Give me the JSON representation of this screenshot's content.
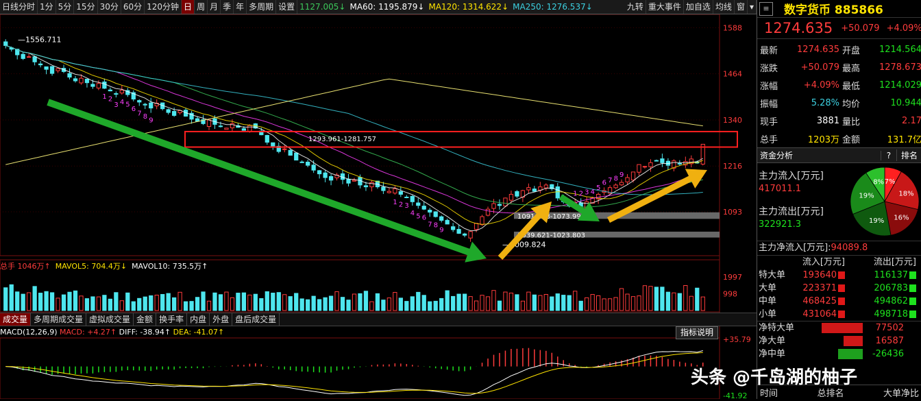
{
  "toolbar": {
    "items": [
      "日线分时",
      "1分",
      "5分",
      "15分",
      "30分",
      "60分",
      "120分钟",
      "日",
      "周",
      "月",
      "季",
      "年",
      "多周期",
      "设置"
    ],
    "active": "日",
    "ma_values": [
      {
        "text": "1127.005↓",
        "color": "#3cc85a"
      },
      {
        "text": "MA60: 1195.879↓",
        "color": "#ffffff"
      },
      {
        "text": "MA120: 1314.622↓",
        "color": "#ffe400"
      },
      {
        "text": "MA250: 1276.537↓",
        "color": "#3cd0e0"
      }
    ],
    "right_items": [
      "九转",
      "重大事件",
      "加自选",
      "均线",
      "窗"
    ]
  },
  "chart_data": {
    "type": "candlestick",
    "price_axis_ticks": [
      1588,
      1464,
      1340,
      1216,
      1093
    ],
    "price_range": [
      975,
      1620
    ],
    "high_label": "1556.711",
    "low_label": "1009.824",
    "zone_labels": [
      {
        "text": "1293.961-1281.757",
        "price": 1290,
        "color": "#ffffff"
      },
      {
        "text": "1091.568-1073.992",
        "price": 1082,
        "color": "#ffffff"
      },
      {
        "text": "1039.621-1023.803",
        "price": 1031,
        "color": "#ffffff"
      }
    ],
    "resistance_box": {
      "low": 1281.757,
      "high": 1293.961
    },
    "support_zones": [
      {
        "low": 1073.992,
        "high": 1091.568
      },
      {
        "low": 1023.803,
        "high": 1039.621
      }
    ],
    "td_counts_down1": [
      "1",
      "2",
      "3",
      "4",
      "5",
      "6",
      "7",
      "8",
      "9"
    ],
    "td_counts_down2": [
      "1",
      "2",
      "3",
      "4",
      "5",
      "6",
      "7",
      "8",
      "9"
    ],
    "td_counts_up": [
      "1",
      "2",
      "3",
      "4",
      "5",
      "6",
      "7",
      "8",
      "9"
    ],
    "close_series": [
      1540,
      1530,
      1515,
      1505,
      1510,
      1496,
      1488,
      1476,
      1465,
      1478,
      1470,
      1455,
      1445,
      1452,
      1440,
      1430,
      1438,
      1425,
      1418,
      1410,
      1420,
      1408,
      1396,
      1388,
      1380,
      1372,
      1385,
      1370,
      1360,
      1352,
      1365,
      1350,
      1342,
      1336,
      1330,
      1340,
      1328,
      1322,
      1318,
      1330,
      1320,
      1312,
      1325,
      1318,
      1300,
      1280,
      1270,
      1255,
      1262,
      1245,
      1232,
      1225,
      1218,
      1205,
      1195,
      1185,
      1178,
      1192,
      1180,
      1170,
      1178,
      1165,
      1160,
      1172,
      1160,
      1150,
      1148,
      1155,
      1140,
      1132,
      1120,
      1110,
      1100,
      1092,
      1080,
      1070,
      1060,
      1045,
      1035,
      1030,
      1040,
      1062,
      1080,
      1100,
      1115,
      1110,
      1130,
      1140,
      1135,
      1150,
      1158,
      1148,
      1160,
      1165,
      1155,
      1130,
      1120,
      1110,
      1118,
      1108,
      1120,
      1130,
      1140,
      1150,
      1158,
      1165,
      1172,
      1185,
      1200,
      1220,
      1215,
      1225,
      1230,
      1225,
      1218,
      1230,
      1222,
      1228,
      1235,
      1224,
      1274.6
    ],
    "volume_axis_ticks": [
      1997,
      998
    ],
    "volume_unit": "万",
    "macd_axis_ticks": [
      35.79,
      -41.92
    ]
  },
  "volume_header": {
    "total": "总手 1046万↑",
    "mavol5": "MAVOL5: 704.4万↓",
    "mavol10": "MAVOL10: 735.5万↑"
  },
  "volume_tabs": [
    "成交量",
    "多周期成交量",
    "虚拟成交量",
    "金额",
    "换手率",
    "内盘",
    "外盘",
    "盘后成交量"
  ],
  "volume_tab_active": "成交量",
  "macd_header": {
    "label": "MACD(12,26,9)",
    "macd": "MACD: +4.27↑",
    "diff": "DIFF: -38.94↑",
    "dea": "DEA: -41.07↑"
  },
  "indicator_button": "指标说明",
  "right_panel": {
    "title": "数字货币 885866",
    "price": "1274.635",
    "change": "+50.079",
    "change_pct": "+4.09%",
    "stats": [
      {
        "l1": "最新",
        "v1": "1274.635",
        "c1": "#ff3c3c",
        "l2": "开盘",
        "v2": "1214.564",
        "c2": "#1ee11e"
      },
      {
        "l1": "涨跌",
        "v1": "+50.079",
        "c1": "#ff3c3c",
        "l2": "最高",
        "v2": "1278.673",
        "c2": "#ff3c3c"
      },
      {
        "l1": "涨幅",
        "v1": "+4.09%",
        "c1": "#ff3c3c",
        "l2": "最低",
        "v2": "1214.029",
        "c2": "#1ee11e"
      },
      {
        "l1": "振幅",
        "v1": "5.28%",
        "c1": "#3cd0e0",
        "l2": "均价",
        "v2": "10.944",
        "c2": "#1ee11e"
      },
      {
        "l1": "现手",
        "v1": "3881",
        "c1": "#ffffff",
        "l2": "量比",
        "v2": "2.17",
        "c2": "#ff3c3c"
      },
      {
        "l1": "总手",
        "v1": "1203万",
        "c1": "#ffe400",
        "l2": "金额",
        "v2": "131.7亿",
        "c2": "#ffe400"
      }
    ],
    "fund_tab": "资金分析",
    "fund_q": "?",
    "fund_rank": "排名",
    "inflow_label": "主力流入[万元]",
    "inflow_value": "417011.1",
    "outflow_label": "主力流出[万元]",
    "outflow_value": "322921.3",
    "net_label": "主力净流入[万元]:",
    "net_value": "94089.8",
    "pie": [
      {
        "label": "7%",
        "pct": 7,
        "color": "#ff2020"
      },
      {
        "label": "18%",
        "pct": 18,
        "color": "#c81818"
      },
      {
        "label": "16%",
        "pct": 16,
        "color": "#8a0c0c"
      },
      {
        "label": "19%",
        "pct": 19,
        "color": "#0f5a0f"
      },
      {
        "label": "19%",
        "pct": 19,
        "color": "#1a8a1a"
      },
      {
        "label": "8%",
        "pct": 8,
        "color": "#2cc02c"
      }
    ],
    "flow_header": {
      "in": "流入[万元]",
      "out": "流出[万元]"
    },
    "flow_rows": [
      {
        "name": "特大单",
        "in": "193640",
        "out": "116137"
      },
      {
        "name": "大单",
        "in": "223371",
        "out": "206783"
      },
      {
        "name": "中单",
        "in": "468425",
        "out": "494862"
      },
      {
        "name": "小单",
        "in": "431064",
        "out": "498718"
      }
    ],
    "net_rows": [
      {
        "name": "净特大单",
        "value": "77502",
        "color": "#ff3c3c",
        "frac": 0.75
      },
      {
        "name": "净大单",
        "value": "16587",
        "color": "#ff3c3c",
        "frac": 0.35
      },
      {
        "name": "净中单",
        "value": "-26436",
        "color": "#1ee11e",
        "frac": 0.45
      }
    ],
    "footer": [
      "时间",
      "总排名",
      "大单净比"
    ]
  },
  "watermark": "头条 @千岛湖的柚子"
}
